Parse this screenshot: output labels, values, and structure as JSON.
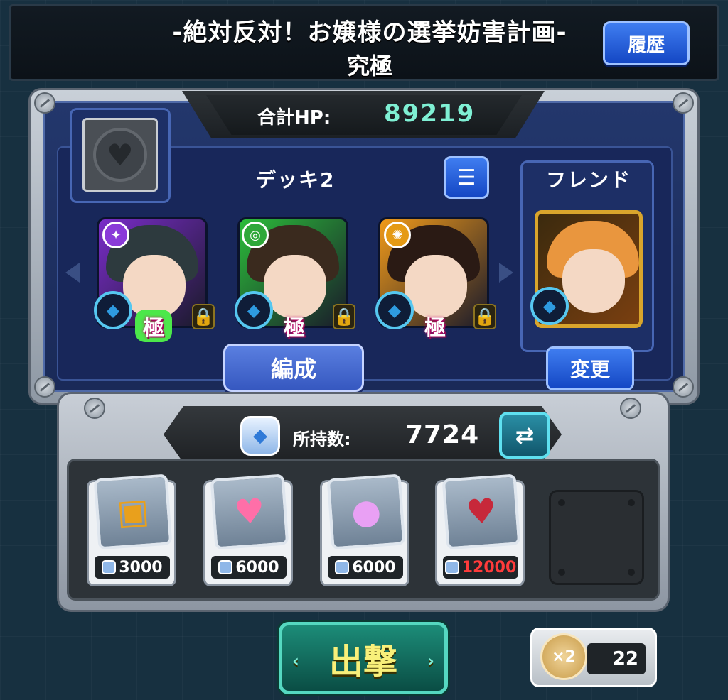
{
  "header": {
    "quest_title": "-絶対反対！お嬢様の選挙妨害計画-",
    "difficulty": "究極",
    "history_button": "履歴"
  },
  "deck": {
    "total_hp_label": "合計HP:",
    "total_hp_value": "89219",
    "deck_name": "デッキ2",
    "list_button_icon": "list-icon",
    "characters": [
      {
        "hair_color": "#2d3a3e",
        "bg_color": "#7a2cc9",
        "element_color": "#8a3ad8",
        "element_symbol": "✦",
        "kiwami": "極",
        "lock_icon": "lock-icon"
      },
      {
        "hair_color": "#3a2a1e",
        "bg_color": "#2bbd3a",
        "element_color": "#2fa83a",
        "element_symbol": "◎",
        "kiwami": "極",
        "lock_icon": "lock-icon"
      },
      {
        "hair_color": "#2a1a14",
        "bg_color": "#f09a1a",
        "element_color": "#e59a14",
        "element_symbol": "✺",
        "kiwami": "極",
        "lock_icon": "lock-icon"
      }
    ],
    "formation_button": "編成",
    "friend_label": "フレンド",
    "friend_hair_color": "#e9963e",
    "change_button": "変更"
  },
  "items": {
    "owned_label": "所持数:",
    "owned_value": "7724",
    "swap_icon": "swap-icon",
    "slots": [
      {
        "icon": "treasure-chest-icon",
        "glyph": "▣",
        "glyph_color": "#e9a01c",
        "price": "3000",
        "price_color": "#ffffff"
      },
      {
        "icon": "heart-plus-icon",
        "glyph": "♥",
        "glyph_color": "#ff6fa8",
        "price": "6000",
        "price_color": "#ffffff"
      },
      {
        "icon": "energy-orb-icon",
        "glyph": "●",
        "glyph_color": "#e9a0f4",
        "price": "6000",
        "price_color": "#ffffff"
      },
      {
        "icon": "berry-icon",
        "glyph": "♥",
        "glyph_color": "#c7283a",
        "price": "12000",
        "price_color": "#ff3b3b"
      }
    ]
  },
  "footer": {
    "sortie_button": "出撃",
    "stamina_multiplier": "×2",
    "stamina_count": "22"
  }
}
